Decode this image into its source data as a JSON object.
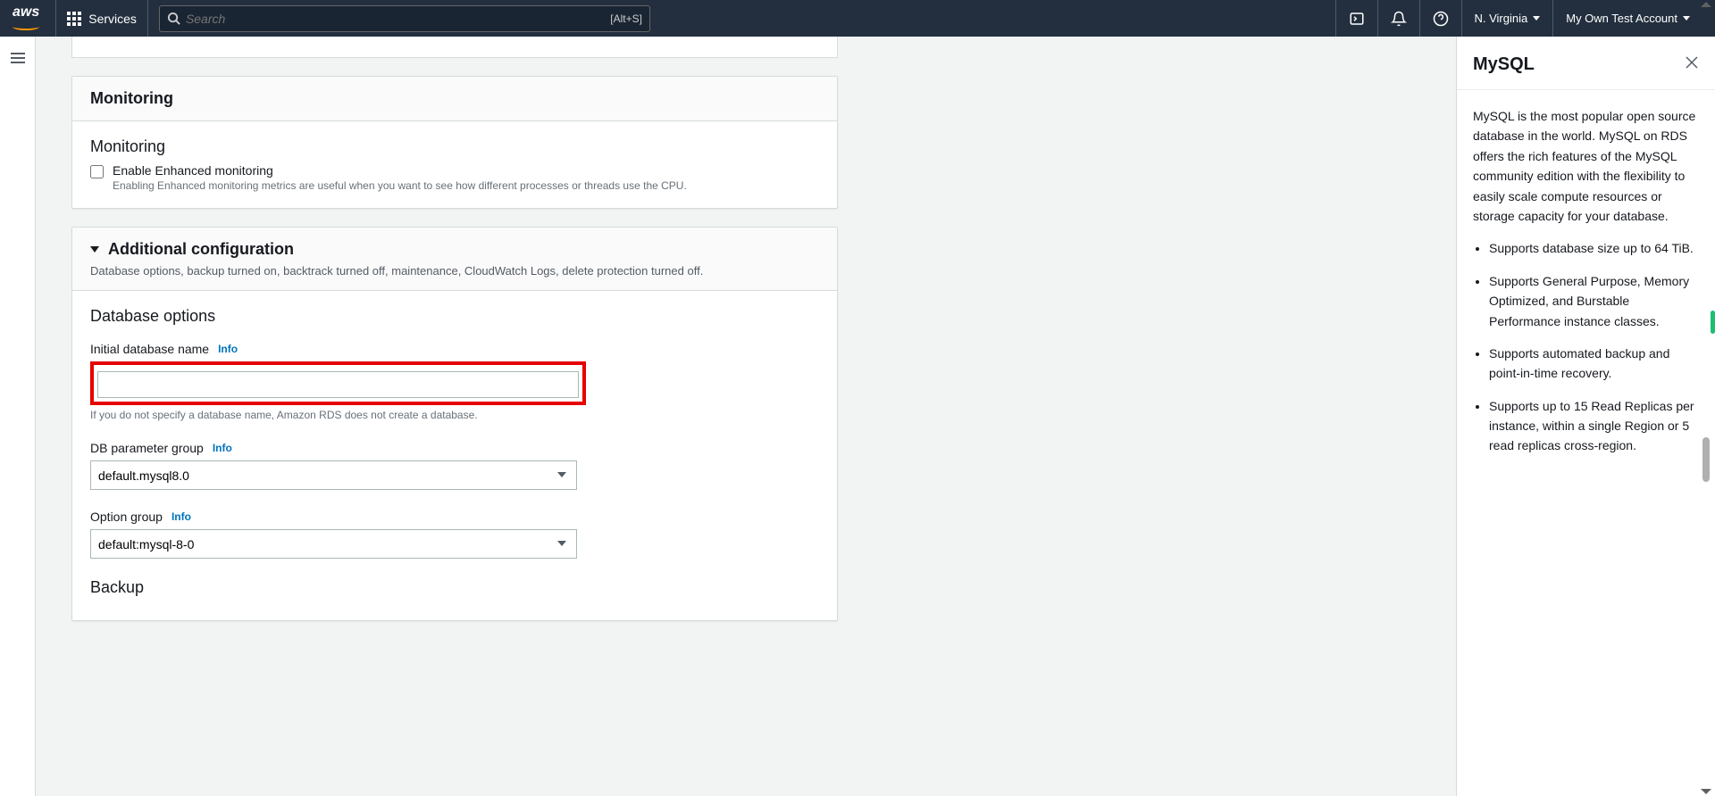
{
  "topnav": {
    "services_label": "Services",
    "search_placeholder": "Search",
    "search_shortcut": "[Alt+S]",
    "region": "N. Virginia",
    "account": "My Own Test Account"
  },
  "monitoring_card": {
    "header": "Monitoring",
    "section_title": "Monitoring",
    "checkbox_label": "Enable Enhanced monitoring",
    "checkbox_hint": "Enabling Enhanced monitoring metrics are useful when you want to see how different processes or threads use the CPU."
  },
  "addl_config": {
    "title": "Additional configuration",
    "subtitle": "Database options, backup turned on, backtrack turned off, maintenance, CloudWatch Logs, delete protection turned off."
  },
  "db_options": {
    "section_title": "Database options",
    "initial_db_label": "Initial database name",
    "initial_db_hint": "If you do not specify a database name, Amazon RDS does not create a database.",
    "initial_db_value": "",
    "param_group_label": "DB parameter group",
    "param_group_value": "default.mysql8.0",
    "option_group_label": "Option group",
    "option_group_value": "default:mysql-8-0",
    "backup_title": "Backup",
    "info": "Info"
  },
  "right_panel": {
    "title": "MySQL",
    "intro": "MySQL is the most popular open source database in the world. MySQL on RDS offers the rich features of the MySQL community edition with the flexibility to easily scale compute resources or storage capacity for your database.",
    "bullets": [
      "Supports database size up to 64 TiB.",
      "Supports General Purpose, Memory Optimized, and Burstable Performance instance classes.",
      "Supports automated backup and point-in-time recovery.",
      "Supports up to 15 Read Replicas per instance, within a single Region or 5 read replicas cross-region."
    ]
  }
}
